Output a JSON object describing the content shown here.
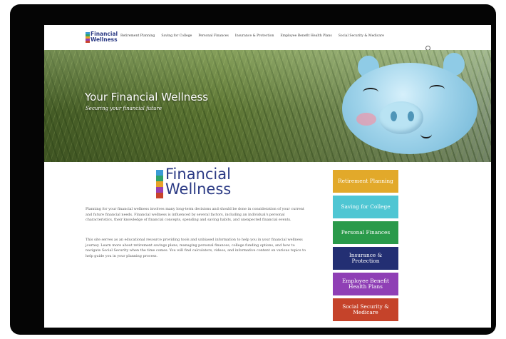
{
  "site": {
    "logo_line1": "Financial",
    "logo_line2": "Wellness",
    "logo_colors": [
      "#3a9bd5",
      "#2fa36a",
      "#e8a228",
      "#9a3fb0",
      "#c8432b"
    ]
  },
  "nav": {
    "items": [
      "Retirement Planning",
      "Saving for College",
      "Personal Finances",
      "Insurance & Protection",
      "Employee Benefit Health Plans",
      "Social Security & Medicare"
    ],
    "search_icon": "search-icon"
  },
  "hero": {
    "title": "Your Financial Wellness",
    "subtitle": "Securing your financial future"
  },
  "main": {
    "paragraph1": "Planning for your financial wellness involves many long-term decisions and should be done in consideration of your current and future financial needs. Financial wellness is influenced by several factors, including an individual's personal characteristics, their knowledge of financial concepts, spending and saving habits, and unexpected financial events.",
    "paragraph2": "This site serves as an educational resource providing tools and unbiased information to help you in your financial wellness journey.  Learn more about retirement savings plans, managing personal finances, college funding options, and how to navigate Social Security when the time comes. You will find calculators, videos, and informative content on various topics to help guide you in your planning process."
  },
  "side_buttons": [
    {
      "label": "Retirement Planning",
      "color": "#e2a92a"
    },
    {
      "label": "Saving for College",
      "color": "#4fc6d3"
    },
    {
      "label": "Personal Finances",
      "color": "#2a9a4a"
    },
    {
      "label": "Insurance & Protection",
      "color": "#232f73"
    },
    {
      "label": "Employee Benefit Health Plans",
      "color": "#8f3fb5"
    },
    {
      "label": "Social Security & Medicare",
      "color": "#c5432a"
    }
  ]
}
